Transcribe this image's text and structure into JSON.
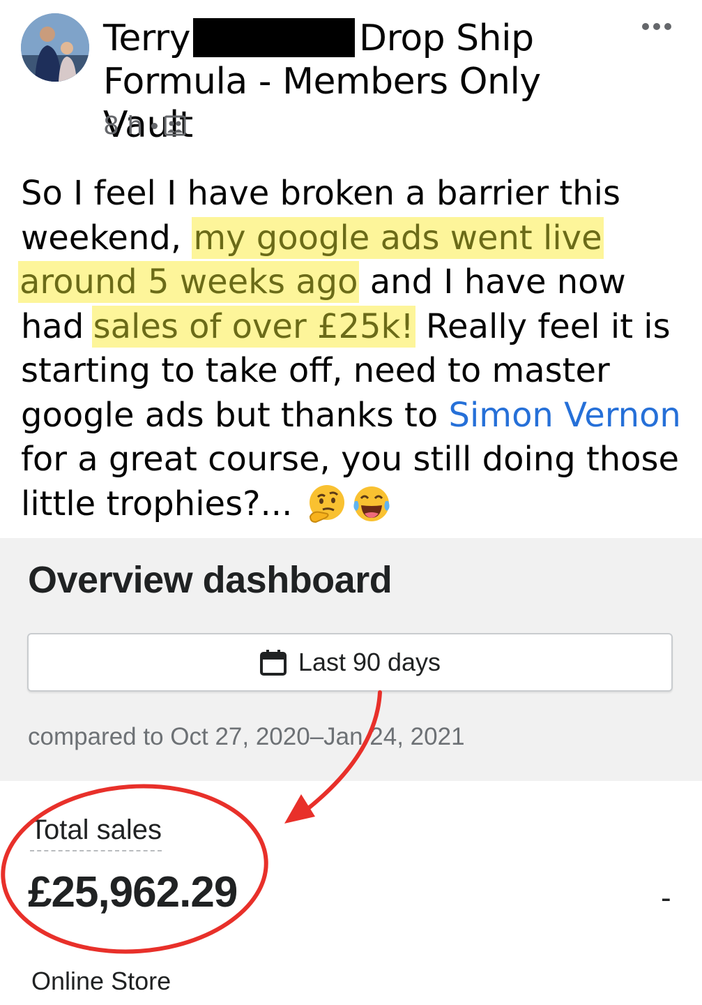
{
  "post": {
    "author_first": "Terry",
    "group_name_line1": "Drop Ship",
    "group_name_line2": "Formula - Members Only Vault",
    "time": "8 h",
    "privacy_icon": "group-icon",
    "more_icon": "more-options-icon",
    "body": {
      "t1": "So I feel I have broken a barrier this weekend, ",
      "h1": "my google ads went live",
      "h2": "around 5 weeks ago",
      "t2": " and I have now had ",
      "h3": "sales of over £25k!",
      "t3": " Really feel it is starting to take off, need to master google ads but thanks to ",
      "mention": "Simon Vernon",
      "t4": " for a great course, you still doing those little trophies?... ",
      "emojis": [
        "thinking-face-emoji",
        "tears-of-joy-emoji"
      ]
    },
    "highlight_color": "#fdf59a",
    "mention_color": "#2670d8"
  },
  "dashboard": {
    "title": "Overview dashboard",
    "date_range_label": "Last 90 days",
    "calendar_icon": "calendar-icon",
    "compare_text": "compared to Oct 27, 2020–Jan 24, 2021",
    "total_sales_label": "Total sales",
    "total_sales_value": "£25,962.29",
    "trend_value": "-",
    "channel_label": "Online Store"
  },
  "annotation": {
    "color": "#e8302a",
    "shapes": [
      "circle-around-total-sales",
      "arrow-to-total-sales"
    ]
  }
}
